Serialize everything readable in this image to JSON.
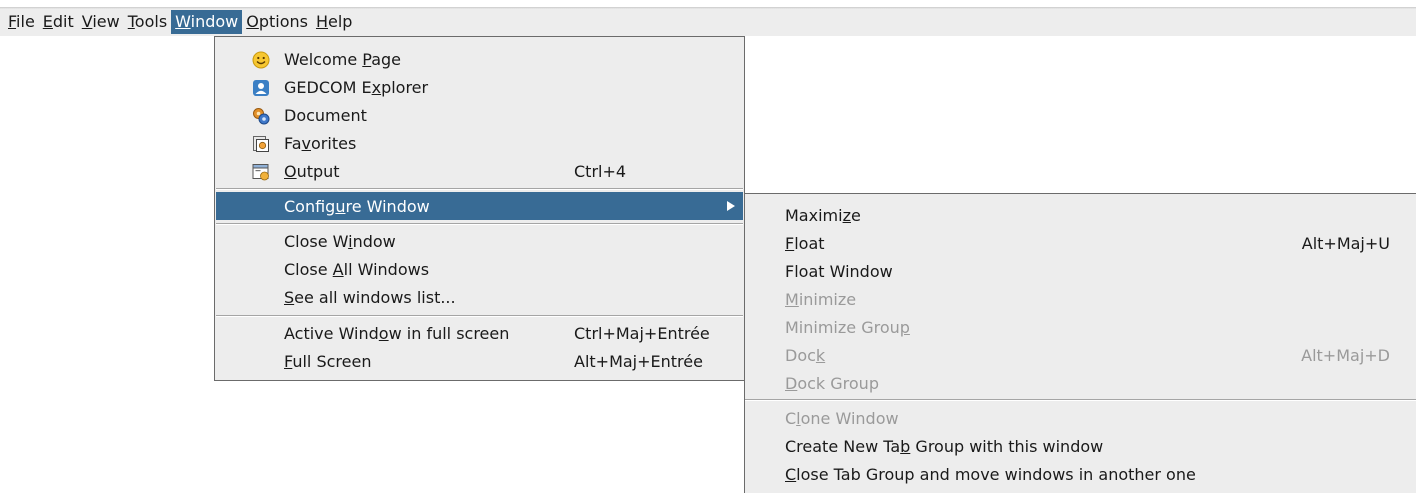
{
  "menubar": {
    "items": [
      {
        "label": "File"
      },
      {
        "label": "Edit"
      },
      {
        "label": "View"
      },
      {
        "label": "Tools"
      },
      {
        "label": "Window"
      },
      {
        "label": "Options"
      },
      {
        "label": "Help"
      }
    ],
    "active": "Window"
  },
  "window_menu": {
    "items": [
      {
        "label": "Welcome Page",
        "icon": "smiley-icon",
        "shortcut": ""
      },
      {
        "label": "GEDCOM Explorer",
        "icon": "person-icon",
        "shortcut": ""
      },
      {
        "label": "Document",
        "icon": "document-gears-icon",
        "shortcut": ""
      },
      {
        "label": "Favorites",
        "icon": "favorites-icon",
        "shortcut": ""
      },
      {
        "label": "Output",
        "icon": "output-icon",
        "shortcut": "Ctrl+4"
      },
      {
        "label": "Configure Window",
        "shortcut": "",
        "highlighted": true,
        "has_submenu": true
      },
      {
        "label": "Close Window",
        "shortcut": ""
      },
      {
        "label": "Close All Windows",
        "shortcut": ""
      },
      {
        "label": "See all windows list...",
        "shortcut": ""
      },
      {
        "label": "Active Window in full screen",
        "shortcut": "Ctrl+Maj+Entrée"
      },
      {
        "label": "Full Screen",
        "shortcut": "Alt+Maj+Entrée"
      }
    ]
  },
  "configure_submenu": {
    "items": [
      {
        "label": "Maximize",
        "shortcut": "",
        "enabled": true
      },
      {
        "label": "Float",
        "shortcut": "Alt+Maj+U",
        "enabled": true
      },
      {
        "label": "Float Window",
        "shortcut": "",
        "enabled": true
      },
      {
        "label": "Minimize",
        "shortcut": "",
        "enabled": false
      },
      {
        "label": "Minimize Group",
        "shortcut": "",
        "enabled": false
      },
      {
        "label": "Dock",
        "shortcut": "Alt+Maj+D",
        "enabled": false
      },
      {
        "label": "Dock Group",
        "shortcut": "",
        "enabled": false
      },
      {
        "label": "Clone Window",
        "shortcut": "",
        "enabled": false
      },
      {
        "label": "Create New Tab Group with this window",
        "shortcut": "",
        "enabled": true
      },
      {
        "label": "Close Tab Group and move windows in another one",
        "shortcut": "",
        "enabled": true
      }
    ]
  },
  "colors": {
    "highlight": "#386b95",
    "menu_bg": "#ededed",
    "disabled_text": "#9a9a9a"
  }
}
